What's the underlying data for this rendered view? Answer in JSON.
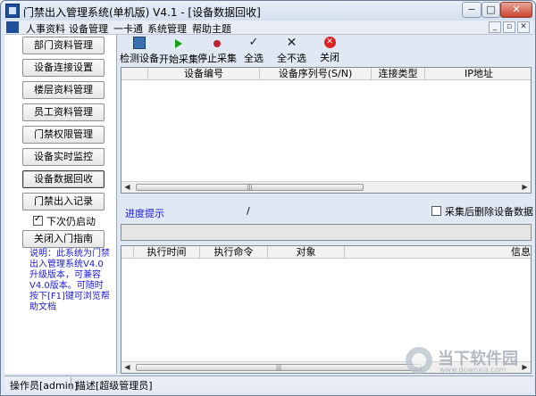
{
  "window": {
    "title": "门禁出入管理系统(单机版)  V4.1 - [设备数据回收]",
    "buttons": {
      "minimize": "−",
      "maximize": "□",
      "close": "✕"
    }
  },
  "menu": {
    "items": [
      "人事资料",
      "设备管理",
      "一卡通",
      "系统管理",
      "帮助主题"
    ],
    "mdi_buttons": [
      "_",
      "▫",
      "✕"
    ]
  },
  "sidebar": {
    "buttons": [
      "部门资料管理",
      "设备连接设置",
      "楼层资料管理",
      "员工资料管理",
      "门禁权限管理",
      "设备实时监控",
      "设备数据回收",
      "门禁出入记录"
    ],
    "active_index": 6,
    "checkbox": {
      "label": "下次仍启动",
      "checked": true
    },
    "extra_button": "关闭入门指南",
    "note": "说明：此系统为门禁出入管理系统V4.0升级版本，可兼容V4.0版本。可随时按下[F1]键可浏览帮助文档"
  },
  "toolbar": {
    "items": [
      {
        "label": "检测设备",
        "icon": "detect-device-icon"
      },
      {
        "label": "开始采集",
        "icon": "play-icon"
      },
      {
        "label": "停止采集",
        "icon": "stop-icon"
      },
      {
        "label": "全选",
        "icon": "check-icon"
      },
      {
        "label": "全不选",
        "icon": "x-icon"
      },
      {
        "label": "关闭",
        "icon": "close-icon"
      }
    ]
  },
  "device_table": {
    "columns": [
      "设备编号",
      "设备序列号(S/N)",
      "连接类型",
      "IP地址"
    ],
    "rows": []
  },
  "progress": {
    "label": "进度提示",
    "value": "/",
    "delete_after_collect": {
      "label": "采集后删除设备数据",
      "checked": false
    },
    "fill_percent": 0
  },
  "log_table": {
    "columns": [
      "执行时间",
      "执行命令",
      "对象",
      "信息"
    ],
    "rows": []
  },
  "statusbar": {
    "operator": "操作员[admin]",
    "description": "描述[超级管理员]"
  },
  "watermark": {
    "text": "当下软件园",
    "sub": "www.downxia.com"
  },
  "colors": {
    "window_bg": "#dfe8f3",
    "link_blue": "#1a1adb",
    "brand_icon": "#1d4f9a"
  }
}
